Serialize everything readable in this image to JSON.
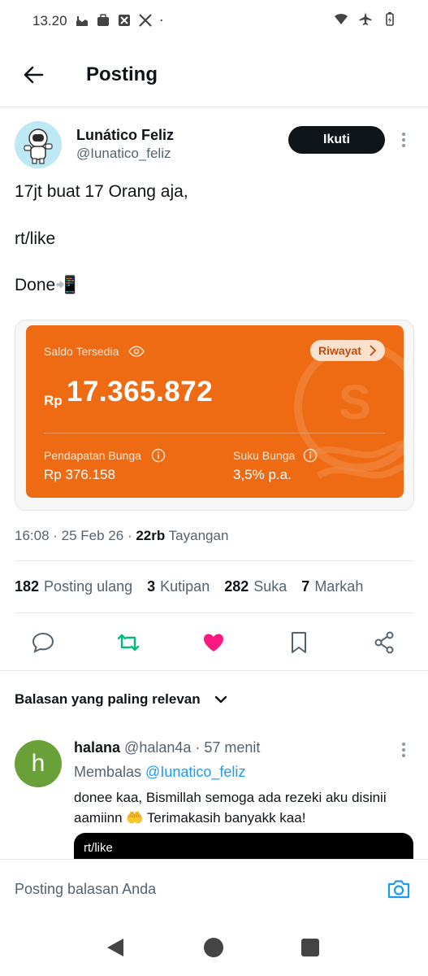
{
  "status_bar": {
    "time": "13.20"
  },
  "header": {
    "title": "Posting"
  },
  "author": {
    "name": "Lunático Feliz",
    "handle": "@Iunatico_feliz",
    "follow_label": "Ikuti"
  },
  "post": {
    "lines": [
      "17jt buat 17 Orang  aja,",
      "rt/like",
      "Done📲"
    ]
  },
  "card": {
    "saldo_label": "Saldo Tersedia",
    "riwayat_label": "Riwayat",
    "currency": "Rp",
    "balance": "17.365.872",
    "interest_label": "Pendapatan Bunga",
    "interest_value": "Rp 376.158",
    "rate_label": "Suku Bunga",
    "rate_value": "3,5% p.a.",
    "accent": "#ee6b13"
  },
  "meta": {
    "time": "16:08",
    "date": "25 Feb 26",
    "views": "22rb",
    "views_label": "Tayangan"
  },
  "stats": {
    "reposts": "182",
    "reposts_label": "Posting ulang",
    "quotes": "3",
    "quotes_label": "Kutipan",
    "likes": "282",
    "likes_label": "Suka",
    "bookmarks": "7",
    "bookmarks_label": "Markah"
  },
  "actions": {
    "icons": [
      "reply-icon",
      "repost-icon",
      "like-icon",
      "bookmark-icon",
      "share-icon"
    ],
    "repost_color": "#00ba7c",
    "like_color": "#f91880"
  },
  "replies": {
    "sort_label": "Balasan yang paling relevan",
    "items": [
      {
        "avatar_letter": "h",
        "name": "halana",
        "handle": "@halan4a",
        "time": "57 menit",
        "replying_prefix": "Membalas",
        "replying_to": "@Iunatico_feliz",
        "text": "donee kaa, Bismillah semoga ada rezeki aku disinii aamiinn 🤲 Terimakasih banyakk kaa!",
        "media_caption": "rt/like"
      }
    ]
  },
  "composer": {
    "placeholder": "Posting balasan Anda"
  }
}
